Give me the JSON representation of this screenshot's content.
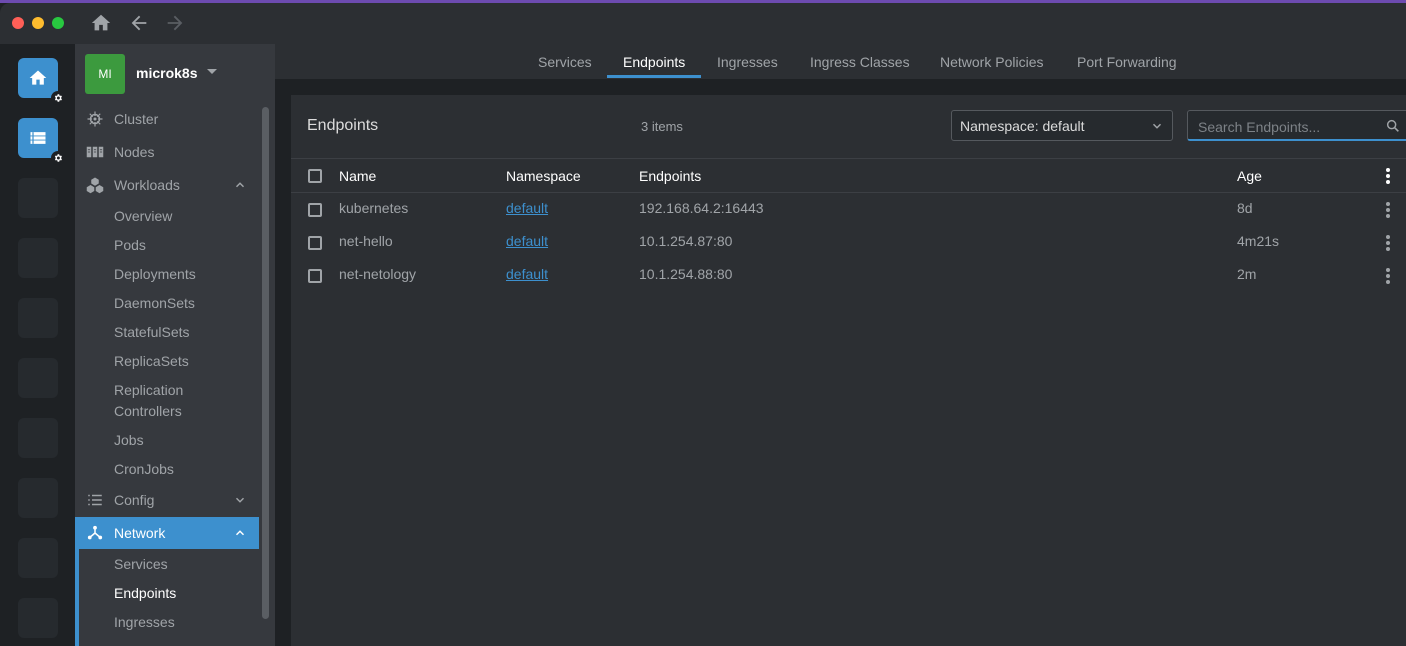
{
  "hotbar": {
    "items": [
      "home",
      "cluster",
      "empty",
      "empty",
      "empty",
      "empty",
      "empty",
      "empty",
      "empty",
      "empty"
    ]
  },
  "cluster": {
    "avatar_text": "MI",
    "name": "microk8s"
  },
  "sidebar": {
    "cluster": "Cluster",
    "nodes": "Nodes",
    "workloads": "Workloads",
    "workloads_items": [
      "Overview",
      "Pods",
      "Deployments",
      "DaemonSets",
      "StatefulSets",
      "ReplicaSets",
      "Replication",
      "Controllers",
      "Jobs",
      "CronJobs"
    ],
    "config": "Config",
    "network": "Network",
    "network_items": [
      "Services",
      "Endpoints",
      "Ingresses"
    ]
  },
  "tabs": [
    "Services",
    "Endpoints",
    "Ingresses",
    "Ingress Classes",
    "Network Policies",
    "Port Forwarding"
  ],
  "active_tab": "Endpoints",
  "panel": {
    "title": "Endpoints",
    "count": "3 items",
    "namespace_select": "Namespace: default",
    "search_placeholder": "Search Endpoints..."
  },
  "table": {
    "headers": [
      "Name",
      "Namespace",
      "Endpoints",
      "Age"
    ],
    "rows": [
      {
        "name": "kubernetes",
        "namespace": "default",
        "endpoints": "192.168.64.2:16443",
        "age": "8d"
      },
      {
        "name": "net-hello",
        "namespace": "default",
        "endpoints": "10.1.254.87:80",
        "age": "4m21s"
      },
      {
        "name": "net-netology",
        "namespace": "default",
        "endpoints": "10.1.254.88:80",
        "age": "2m"
      }
    ]
  },
  "colors": {
    "accent": "#3d90ce",
    "avatar": "#3c9a3e",
    "sidebar_bg": "#36393e",
    "panel_bg": "#2c2f33"
  }
}
